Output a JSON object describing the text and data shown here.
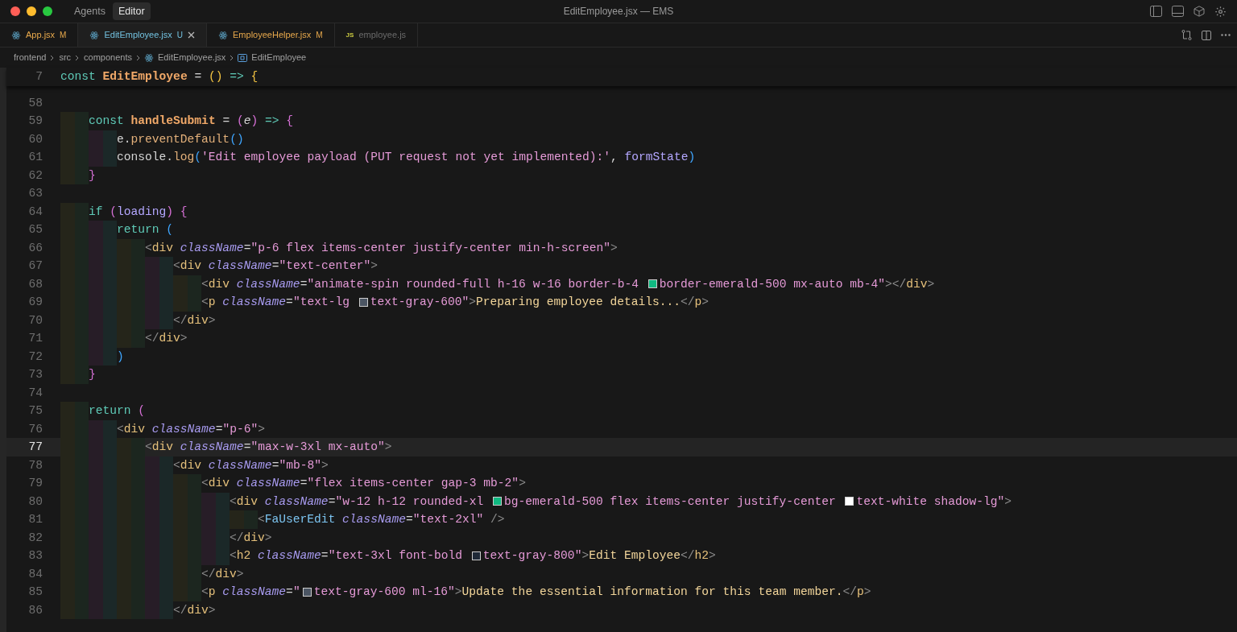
{
  "window": {
    "title": "EditEmployee.jsx — EMS",
    "modes": [
      {
        "label": "Agents",
        "selected": false
      },
      {
        "label": "Editor",
        "selected": true
      }
    ]
  },
  "tabs": [
    {
      "name": "App.jsx",
      "kind": "react",
      "modified": true,
      "untracked": false,
      "badge": "M",
      "selected": false
    },
    {
      "name": "EditEmployee.jsx",
      "kind": "react",
      "modified": false,
      "untracked": true,
      "badge": "U",
      "selected": true
    },
    {
      "name": "EmployeeHelper.jsx",
      "kind": "react",
      "modified": true,
      "untracked": false,
      "badge": "M",
      "selected": false
    },
    {
      "name": "employee.js",
      "kind": "js",
      "icon_label": "JS",
      "modified": false,
      "untracked": false,
      "selected": false
    }
  ],
  "breadcrumb": [
    {
      "kind": "folder",
      "text": "frontend"
    },
    {
      "kind": "folder",
      "text": "src"
    },
    {
      "kind": "folder",
      "text": "components"
    },
    {
      "kind": "file",
      "text": "EditEmployee.jsx"
    },
    {
      "kind": "symbol",
      "text": "EditEmployee"
    }
  ],
  "sticky_line": {
    "number": "7",
    "tokens": [
      {
        "kind": "kw",
        "text": "const "
      },
      {
        "kind": "fn",
        "text": "EditEmployee"
      },
      {
        "kind": "plain",
        "text": " = "
      },
      {
        "kind": "yparen",
        "text": "()"
      },
      {
        "kind": "kw",
        "text": " => "
      },
      {
        "kind": "yparen",
        "text": "{"
      }
    ]
  },
  "lines": [
    {
      "number": "58",
      "current": false
    },
    {
      "number": "59",
      "current": false,
      "tokens": [
        {
          "kind": "kw",
          "text": "    const "
        },
        {
          "kind": "fn",
          "text": "handleSubmit"
        },
        {
          "kind": "plain",
          "text": " = "
        },
        {
          "kind": "brace",
          "text": "("
        },
        {
          "kind": "param",
          "text": "e"
        },
        {
          "kind": "brace",
          "text": ")"
        },
        {
          "kind": "kw",
          "text": " => "
        },
        {
          "kind": "brace",
          "text": "{"
        }
      ]
    },
    {
      "number": "60",
      "current": false,
      "tokens": [
        {
          "kind": "plain",
          "text": "        e."
        },
        {
          "kind": "method",
          "text": "preventDefault"
        },
        {
          "kind": "bparen",
          "text": "()"
        }
      ]
    },
    {
      "number": "61",
      "current": false,
      "tokens": [
        {
          "kind": "plain",
          "text": "        console."
        },
        {
          "kind": "method",
          "text": "log"
        },
        {
          "kind": "bparen",
          "text": "("
        },
        {
          "kind": "string",
          "text": "'Edit employee payload (PUT request not yet implemented):'"
        },
        {
          "kind": "plain",
          "text": ", "
        },
        {
          "kind": "var",
          "text": "formState"
        },
        {
          "kind": "bparen",
          "text": ")"
        }
      ]
    },
    {
      "number": "62",
      "current": false,
      "tokens": [
        {
          "kind": "brace",
          "text": "    }"
        }
      ]
    },
    {
      "number": "63",
      "current": false
    },
    {
      "number": "64",
      "current": false,
      "tokens": [
        {
          "kind": "kw",
          "text": "    if "
        },
        {
          "kind": "brace",
          "text": "("
        },
        {
          "kind": "var",
          "text": "loading"
        },
        {
          "kind": "brace",
          "text": ") {"
        }
      ]
    },
    {
      "number": "65",
      "current": false,
      "tokens": [
        {
          "kind": "kw",
          "text": "        return "
        },
        {
          "kind": "bparen",
          "text": "("
        }
      ]
    },
    {
      "number": "66",
      "current": false,
      "tokens": [
        {
          "kind": "punct",
          "text": "            <"
        },
        {
          "kind": "tag",
          "text": "div"
        },
        {
          "kind": "attr",
          "text": " className"
        },
        {
          "kind": "plain",
          "text": "="
        },
        {
          "kind": "string",
          "text": "\"p-6 flex items-center justify-center min-h-screen\""
        },
        {
          "kind": "punct",
          "text": ">"
        }
      ]
    },
    {
      "number": "67",
      "current": false,
      "tokens": [
        {
          "kind": "punct",
          "text": "                <"
        },
        {
          "kind": "tag",
          "text": "div"
        },
        {
          "kind": "attr",
          "text": " className"
        },
        {
          "kind": "plain",
          "text": "="
        },
        {
          "kind": "string",
          "text": "\"text-center\""
        },
        {
          "kind": "punct",
          "text": ">"
        }
      ]
    },
    {
      "number": "68",
      "current": false,
      "tokens": [
        {
          "kind": "punct",
          "text": "                    <"
        },
        {
          "kind": "tag",
          "text": "div"
        },
        {
          "kind": "attr",
          "text": " className"
        },
        {
          "kind": "plain",
          "text": "="
        },
        {
          "kind": "string",
          "text": "\"animate-spin rounded-full h-16 w-16 border-b-4 "
        },
        {
          "kind": "swatch",
          "color": "#10b981"
        },
        {
          "kind": "string",
          "text": "border-emerald-500 mx-auto mb-4\""
        },
        {
          "kind": "punct",
          "text": "></"
        },
        {
          "kind": "tag",
          "text": "div"
        },
        {
          "kind": "punct",
          "text": ">"
        }
      ]
    },
    {
      "number": "69",
      "current": false,
      "tokens": [
        {
          "kind": "punct",
          "text": "                    <"
        },
        {
          "kind": "tag",
          "text": "p"
        },
        {
          "kind": "attr",
          "text": " className"
        },
        {
          "kind": "plain",
          "text": "="
        },
        {
          "kind": "string",
          "text": "\"text-lg "
        },
        {
          "kind": "swatch",
          "color": "#4b5563"
        },
        {
          "kind": "string",
          "text": "text-gray-600\""
        },
        {
          "kind": "punct",
          "text": ">"
        },
        {
          "kind": "jsxtext",
          "text": "Preparing employee details..."
        },
        {
          "kind": "punct",
          "text": "</"
        },
        {
          "kind": "tag",
          "text": "p"
        },
        {
          "kind": "punct",
          "text": ">"
        }
      ]
    },
    {
      "number": "70",
      "current": false,
      "tokens": [
        {
          "kind": "punct",
          "text": "                </"
        },
        {
          "kind": "tag",
          "text": "div"
        },
        {
          "kind": "punct",
          "text": ">"
        }
      ]
    },
    {
      "number": "71",
      "current": false,
      "tokens": [
        {
          "kind": "punct",
          "text": "            </"
        },
        {
          "kind": "tag",
          "text": "div"
        },
        {
          "kind": "punct",
          "text": ">"
        }
      ]
    },
    {
      "number": "72",
      "current": false,
      "tokens": [
        {
          "kind": "bparen",
          "text": "        )"
        }
      ]
    },
    {
      "number": "73",
      "current": false,
      "tokens": [
        {
          "kind": "brace",
          "text": "    }"
        }
      ]
    },
    {
      "number": "74",
      "current": false
    },
    {
      "number": "75",
      "current": false,
      "tokens": [
        {
          "kind": "kw",
          "text": "    return "
        },
        {
          "kind": "brace",
          "text": "("
        }
      ]
    },
    {
      "number": "76",
      "current": false,
      "tokens": [
        {
          "kind": "punct",
          "text": "        <"
        },
        {
          "kind": "tag",
          "text": "div"
        },
        {
          "kind": "attr",
          "text": " className"
        },
        {
          "kind": "plain",
          "text": "="
        },
        {
          "kind": "string",
          "text": "\"p-6\""
        },
        {
          "kind": "punct",
          "text": ">"
        }
      ]
    },
    {
      "number": "77",
      "current": true,
      "tokens": [
        {
          "kind": "punct",
          "text": "            <"
        },
        {
          "kind": "tag",
          "text": "div"
        },
        {
          "kind": "attr",
          "text": " className"
        },
        {
          "kind": "plain",
          "text": "="
        },
        {
          "kind": "string",
          "text": "\"max-w-3xl mx-auto\""
        },
        {
          "kind": "punct",
          "text": ">"
        }
      ]
    },
    {
      "number": "78",
      "current": false,
      "tokens": [
        {
          "kind": "punct",
          "text": "                <"
        },
        {
          "kind": "tag",
          "text": "div"
        },
        {
          "kind": "attr",
          "text": " className"
        },
        {
          "kind": "plain",
          "text": "="
        },
        {
          "kind": "string",
          "text": "\"mb-8\""
        },
        {
          "kind": "punct",
          "text": ">"
        }
      ]
    },
    {
      "number": "79",
      "current": false,
      "tokens": [
        {
          "kind": "punct",
          "text": "                    <"
        },
        {
          "kind": "tag",
          "text": "div"
        },
        {
          "kind": "attr",
          "text": " className"
        },
        {
          "kind": "plain",
          "text": "="
        },
        {
          "kind": "string",
          "text": "\"flex items-center gap-3 mb-2\""
        },
        {
          "kind": "punct",
          "text": ">"
        }
      ]
    },
    {
      "number": "80",
      "current": false,
      "tokens": [
        {
          "kind": "punct",
          "text": "                        <"
        },
        {
          "kind": "tag",
          "text": "div"
        },
        {
          "kind": "attr",
          "text": " className"
        },
        {
          "kind": "plain",
          "text": "="
        },
        {
          "kind": "string",
          "text": "\"w-12 h-12 rounded-xl "
        },
        {
          "kind": "swatch",
          "color": "#10b981"
        },
        {
          "kind": "string",
          "text": "bg-emerald-500 flex items-center justify-center "
        },
        {
          "kind": "swatch",
          "color": "#ffffff"
        },
        {
          "kind": "string",
          "text": "text-white shadow-lg\""
        },
        {
          "kind": "punct",
          "text": ">"
        }
      ]
    },
    {
      "number": "81",
      "current": false,
      "tokens": [
        {
          "kind": "punct",
          "text": "                            <"
        },
        {
          "kind": "component",
          "text": "FaUserEdit"
        },
        {
          "kind": "attr",
          "text": " className"
        },
        {
          "kind": "plain",
          "text": "="
        },
        {
          "kind": "string",
          "text": "\"text-2xl\""
        },
        {
          "kind": "punct",
          "text": " />"
        }
      ]
    },
    {
      "number": "82",
      "current": false,
      "tokens": [
        {
          "kind": "punct",
          "text": "                        </"
        },
        {
          "kind": "tag",
          "text": "div"
        },
        {
          "kind": "punct",
          "text": ">"
        }
      ]
    },
    {
      "number": "83",
      "current": false,
      "tokens": [
        {
          "kind": "punct",
          "text": "                        <"
        },
        {
          "kind": "tag",
          "text": "h2"
        },
        {
          "kind": "attr",
          "text": " className"
        },
        {
          "kind": "plain",
          "text": "="
        },
        {
          "kind": "string",
          "text": "\"text-3xl font-bold "
        },
        {
          "kind": "swatch",
          "color": "#1f2937"
        },
        {
          "kind": "string",
          "text": "text-gray-800\""
        },
        {
          "kind": "punct",
          "text": ">"
        },
        {
          "kind": "jsxtext",
          "text": "Edit Employee"
        },
        {
          "kind": "punct",
          "text": "</"
        },
        {
          "kind": "tag",
          "text": "h2"
        },
        {
          "kind": "punct",
          "text": ">"
        }
      ]
    },
    {
      "number": "84",
      "current": false,
      "tokens": [
        {
          "kind": "punct",
          "text": "                    </"
        },
        {
          "kind": "tag",
          "text": "div"
        },
        {
          "kind": "punct",
          "text": ">"
        }
      ]
    },
    {
      "number": "85",
      "current": false,
      "tokens": [
        {
          "kind": "punct",
          "text": "                    <"
        },
        {
          "kind": "tag",
          "text": "p"
        },
        {
          "kind": "attr",
          "text": " className"
        },
        {
          "kind": "plain",
          "text": "="
        },
        {
          "kind": "string",
          "text": "\""
        },
        {
          "kind": "swatch",
          "color": "#4b5563"
        },
        {
          "kind": "string",
          "text": "text-gray-600 ml-16\""
        },
        {
          "kind": "punct",
          "text": ">"
        },
        {
          "kind": "jsxtext",
          "text": "Update the essential information for this team member."
        },
        {
          "kind": "punct",
          "text": "</"
        },
        {
          "kind": "tag",
          "text": "p"
        },
        {
          "kind": "punct",
          "text": ">"
        }
      ]
    },
    {
      "number": "86",
      "current": false,
      "tokens": [
        {
          "kind": "punct",
          "text": "                </"
        },
        {
          "kind": "tag",
          "text": "div"
        },
        {
          "kind": "punct",
          "text": ">"
        }
      ]
    }
  ]
}
